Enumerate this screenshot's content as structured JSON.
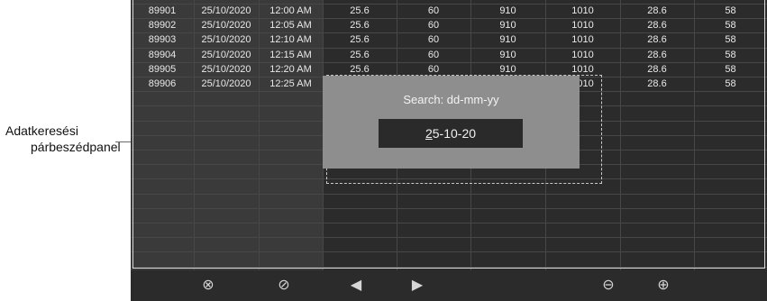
{
  "callout": {
    "line1": "Adatkeresési",
    "line2": "párbeszédpanel"
  },
  "table": {
    "rows": [
      [
        "89901",
        "25/10/2020",
        "12:00 AM",
        "25.6",
        "60",
        "910",
        "1010",
        "28.6",
        "58"
      ],
      [
        "89902",
        "25/10/2020",
        "12:05 AM",
        "25.6",
        "60",
        "910",
        "1010",
        "28.6",
        "58"
      ],
      [
        "89903",
        "25/10/2020",
        "12:10 AM",
        "25.6",
        "60",
        "910",
        "1010",
        "28.6",
        "58"
      ],
      [
        "89904",
        "25/10/2020",
        "12:15 AM",
        "25.6",
        "60",
        "910",
        "1010",
        "28.6",
        "58"
      ],
      [
        "89905",
        "25/10/2020",
        "12:20 AM",
        "25.6",
        "60",
        "910",
        "1010",
        "28.6",
        "58"
      ],
      [
        "89906",
        "25/10/2020",
        "12:25 AM",
        "25.6",
        "60",
        "910",
        "1010",
        "28.6",
        "58"
      ]
    ]
  },
  "dialog": {
    "title": "Search: dd-mm-yy",
    "value": "25-10-20"
  },
  "toolbar": {
    "cancel_icon": "⊗",
    "ok_icon": "⊘",
    "prev_icon": "◀",
    "next_icon": "▶",
    "zoom_out_icon": "⊖",
    "zoom_in_icon": "⊕"
  }
}
